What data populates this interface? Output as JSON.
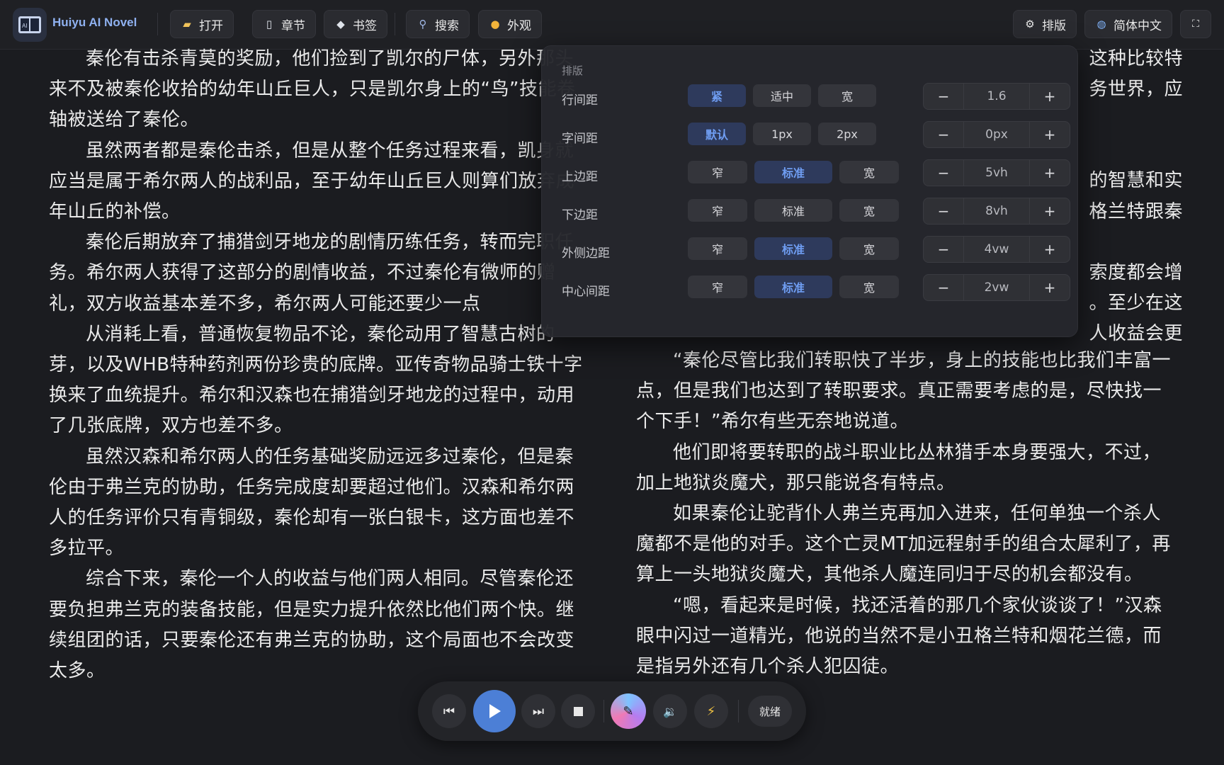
{
  "header": {
    "app_name": "Huiyu AI Novel",
    "buttons": {
      "open": "打开",
      "chapters": "章节",
      "bookmarks": "书签",
      "search": "搜索",
      "appearance": "外观",
      "layout": "排版",
      "language": "简体中文"
    }
  },
  "content": {
    "left_paragraphs": [
      "秦伦有击杀青莫的奖励，他们捡到了凯尔的尸体，另外那头来不及被秦伦收拾的幼年山丘巨人，只是凯尔身上的“鸟”技能卷轴被送给了秦伦。",
      "虽然两者都是秦伦击杀，但是从整个任务过程来看，凯身就应当是属于希尔两人的战利品，至于幼年山丘巨人则算们放弃成年山丘的补偿。",
      "秦伦后期放弃了捕猎剑牙地龙的剧情历练任务，转而完职任务。希尔两人获得了这部分的剧情收益，不过秦伦有微师的赠礼，双方收益基本差不多，希尔两人可能还要少一点",
      "从消耗上看，普通恢复物品不论，秦伦动用了智慧古树的芽，以及WHB特种药剂两份珍贵的底牌。亚传奇物品骑士铁十字换来了血统提升。希尔和汉森也在捕猎剑牙地龙的过程中，动用了几张底牌，双方也差不多。",
      "虽然汉森和希尔两人的任务基础奖励远远多过秦伦，但是秦伦由于弗兰克的协助，任务完成度却要超过他们。汉森和希尔两人的任务评价只有青铜级，秦伦却有一张白银卡，这方面也差不多拉平。",
      "综合下来，秦伦一个人的收益与他们两人相同。尽管秦伦还要负担弗兰克的装备技能，但是实力提升依然比他们两个快。继续组团的话，只要秦伦还有弗兰克的协助，这个局面也不会改变太多。"
    ],
    "right_visible_fragments": [
      "这种比较特",
      "务世界，应",
      "的智慧和实",
      "格兰特跟秦",
      "索度都会增",
      "。至少在这",
      "人收益会更"
    ],
    "right_paragraphs": [
      "“秦伦尽管比我们转职快了半步，身上的技能也比我们丰富一点，但是我们也达到了转职要求。真正需要考虑的是，尽快找一个下手！”希尔有些无奈地说道。",
      "他们即将要转职的战斗职业比丛林猎手本身要强大，不过，加上地狱炎魔犬，那只能说各有特点。",
      "如果秦伦让驼背仆人弗兰克再加入进来，任何单独一个杀人魔都不是他的对手。这个亡灵MT加远程射手的组合太犀利了，再算上一头地狱炎魔犬，其他杀人魔连同归于尽的机会都没有。",
      "“嗯，看起来是时候，找还活着的那几个家伙谈谈了！”汉森眼中闪过一道精光，他说的当然不是小丑格兰特和烟花兰德，而是指另外还有几个杀人犯囚徒。"
    ]
  },
  "layout_panel": {
    "title": "排版",
    "rows": [
      {
        "label": "行间距",
        "options": [
          "紧",
          "适中",
          "宽"
        ],
        "selected": "紧",
        "value": "1.6"
      },
      {
        "label": "字间距",
        "options": [
          "默认",
          "1px",
          "2px"
        ],
        "selected": "默认",
        "value": "0px"
      },
      {
        "label": "上边距",
        "options": [
          "窄",
          "标准",
          "宽"
        ],
        "selected": "标准",
        "value": "5vh"
      },
      {
        "label": "下边距",
        "options": [
          "窄",
          "标准",
          "宽"
        ],
        "selected": "none",
        "value": "8vh"
      },
      {
        "label": "外侧边距",
        "options": [
          "窄",
          "标准",
          "宽"
        ],
        "selected": "标准",
        "value": "4vw"
      },
      {
        "label": "中心间距",
        "options": [
          "窄",
          "标准",
          "宽"
        ],
        "selected": "标准",
        "value": "2vw"
      }
    ],
    "minus": "−",
    "plus": "+"
  },
  "player": {
    "status": "就绪",
    "icons": [
      "skip-back-icon",
      "play-icon",
      "skip-forward-icon",
      "stop-icon",
      "voice-orb-icon",
      "volume-icon",
      "speed-icon"
    ]
  },
  "colors": {
    "background": "#1b1c20",
    "accent": "#4c7fd6",
    "active_text": "#6f9df2"
  }
}
